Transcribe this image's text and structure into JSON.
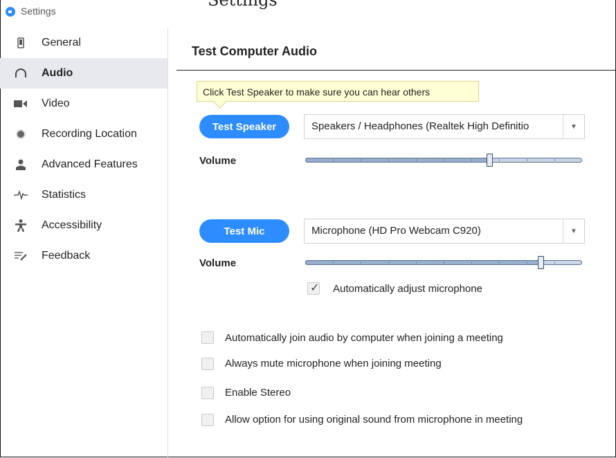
{
  "window": {
    "title": "Settings",
    "top_fragment": "Settings"
  },
  "sidebar": {
    "items": [
      {
        "label": "General",
        "icon": "phone-icon",
        "active": false
      },
      {
        "label": "Audio",
        "icon": "headphones-icon",
        "active": true
      },
      {
        "label": "Video",
        "icon": "video-camera-icon",
        "active": false
      },
      {
        "label": "Recording Location",
        "icon": "record-icon",
        "active": false
      },
      {
        "label": "Advanced Features",
        "icon": "person-icon",
        "active": false
      },
      {
        "label": "Statistics",
        "icon": "pulse-icon",
        "active": false
      },
      {
        "label": "Accessibility",
        "icon": "accessibility-icon",
        "active": false
      },
      {
        "label": "Feedback",
        "icon": "feedback-icon",
        "active": false
      }
    ]
  },
  "main": {
    "title": "Test Computer Audio",
    "tooltip": "Click Test Speaker to make sure you can hear others",
    "speaker": {
      "button": "Test Speaker",
      "device": "Speakers / Headphones (Realtek High Definitio",
      "volume_label": "Volume",
      "volume_fraction": 0.67
    },
    "mic": {
      "button": "Test Mic",
      "device": "Microphone (HD Pro Webcam C920)",
      "volume_label": "Volume",
      "volume_fraction": 0.86,
      "auto_adjust_label": "Automatically adjust microphone",
      "auto_adjust_checked": true
    },
    "options": [
      {
        "label": "Automatically join audio by computer when joining a meeting",
        "checked": false
      },
      {
        "label": "Always mute microphone when joining meeting",
        "checked": false
      },
      {
        "label": "Enable Stereo",
        "checked": false
      },
      {
        "label": "Allow option for using original sound from microphone in meeting",
        "checked": false
      }
    ]
  },
  "colors": {
    "accent": "#2d8cff",
    "sidebar_active": "#e7e9ee",
    "tooltip_bg": "#ffffd6"
  }
}
